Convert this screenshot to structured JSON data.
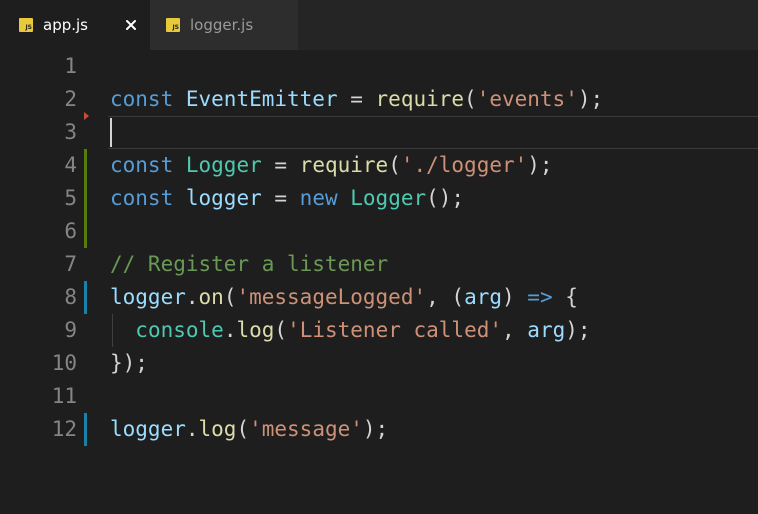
{
  "tabs": [
    {
      "icon": "JS",
      "label": "app.js",
      "active": true,
      "close": "×"
    },
    {
      "icon": "JS",
      "label": "logger.js",
      "active": false
    }
  ],
  "editor": {
    "line_numbers": [
      "1",
      "2",
      "3",
      "4",
      "5",
      "6",
      "7",
      "8",
      "9",
      "10",
      "11",
      "12"
    ],
    "lines": [
      [],
      [
        [
          "kw",
          "const"
        ],
        [
          "punc",
          " "
        ],
        [
          "cls",
          "EventEmitter"
        ],
        [
          "punc",
          " = "
        ],
        [
          "fn",
          "require"
        ],
        [
          "punc",
          "("
        ],
        [
          "str",
          "'events'"
        ],
        [
          "punc",
          ");"
        ]
      ],
      [],
      [
        [
          "kw",
          "const"
        ],
        [
          "punc",
          " "
        ],
        [
          "type",
          "Logger"
        ],
        [
          "punc",
          " = "
        ],
        [
          "fn",
          "require"
        ],
        [
          "punc",
          "("
        ],
        [
          "str",
          "'./logger'"
        ],
        [
          "punc",
          ");"
        ]
      ],
      [
        [
          "kw",
          "const"
        ],
        [
          "punc",
          " "
        ],
        [
          "var",
          "logger"
        ],
        [
          "punc",
          " = "
        ],
        [
          "kw",
          "new"
        ],
        [
          "punc",
          " "
        ],
        [
          "type",
          "Logger"
        ],
        [
          "punc",
          "();"
        ]
      ],
      [],
      [
        [
          "cmt",
          "// Register a listener"
        ]
      ],
      [
        [
          "var",
          "logger"
        ],
        [
          "punc",
          "."
        ],
        [
          "fn",
          "on"
        ],
        [
          "punc",
          "("
        ],
        [
          "str",
          "'messageLogged'"
        ],
        [
          "punc",
          ", ("
        ],
        [
          "var",
          "arg"
        ],
        [
          "punc",
          ") "
        ],
        [
          "kw",
          "=>"
        ],
        [
          "punc",
          " {"
        ]
      ],
      [
        [
          "punc",
          "  "
        ],
        [
          "type",
          "console"
        ],
        [
          "punc",
          "."
        ],
        [
          "fn",
          "log"
        ],
        [
          "punc",
          "("
        ],
        [
          "str",
          "'Listener called'"
        ],
        [
          "punc",
          ", "
        ],
        [
          "var",
          "arg"
        ],
        [
          "punc",
          ");"
        ]
      ],
      [
        [
          "punc",
          "});"
        ]
      ],
      [],
      [
        [
          "var",
          "logger"
        ],
        [
          "punc",
          "."
        ],
        [
          "fn",
          "log"
        ],
        [
          "punc",
          "("
        ],
        [
          "str",
          "'message'"
        ],
        [
          "punc",
          ");"
        ]
      ]
    ]
  },
  "colors": {
    "background": "#1e1e1e",
    "tab_bar": "#252526",
    "inactive_tab": "#2d2d2d",
    "js_icon": "#e8c93c",
    "keyword": "#569cd6",
    "string": "#ce9178",
    "function": "#dcdcaa",
    "type": "#4ec9b0",
    "variable": "#9cdcfe",
    "comment": "#6a9955",
    "gutter_added": "#587c0c",
    "gutter_modified": "#1b81a8",
    "gutter_deleted": "#c74e39"
  }
}
